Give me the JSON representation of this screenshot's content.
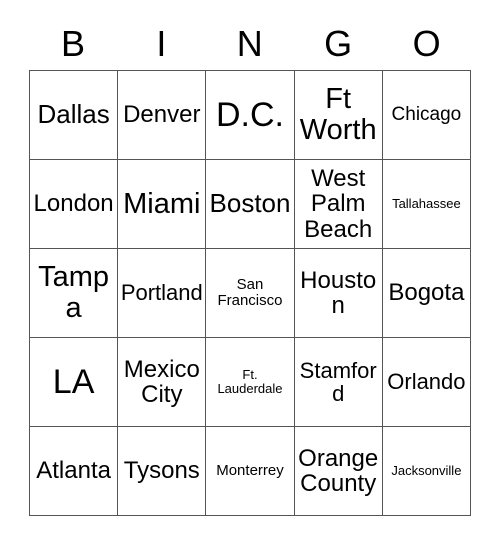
{
  "card": {
    "title": "BINGO card",
    "header_letters": [
      "B",
      "I",
      "N",
      "G",
      "O"
    ],
    "columns": 5,
    "rows": 5,
    "colors": {
      "border": "#555555",
      "text": "#000000",
      "background": "#ffffff"
    }
  },
  "cells": [
    {
      "text": "Dallas",
      "row": 1,
      "col": 1,
      "column_letter": "B",
      "size": "lg"
    },
    {
      "text": "Denver",
      "row": 1,
      "col": 2,
      "column_letter": "I",
      "size": "md"
    },
    {
      "text": "D.C.",
      "row": 1,
      "col": 3,
      "column_letter": "N",
      "size": "xxl"
    },
    {
      "text": "Ft Worth",
      "row": 1,
      "col": 4,
      "column_letter": "G",
      "size": "xl"
    },
    {
      "text": "Chicago",
      "row": 1,
      "col": 5,
      "column_letter": "O",
      "size": "xs"
    },
    {
      "text": "London",
      "row": 2,
      "col": 1,
      "column_letter": "B",
      "size": "md"
    },
    {
      "text": "Miami",
      "row": 2,
      "col": 2,
      "column_letter": "I",
      "size": "xl"
    },
    {
      "text": "Boston",
      "row": 2,
      "col": 3,
      "column_letter": "N",
      "size": "lg"
    },
    {
      "text": "West Palm Beach",
      "row": 2,
      "col": 4,
      "column_letter": "G",
      "size": "md"
    },
    {
      "text": "Tallahassee",
      "row": 2,
      "col": 5,
      "column_letter": "O",
      "size": "tiny"
    },
    {
      "text": "Tampa",
      "row": 3,
      "col": 1,
      "column_letter": "B",
      "size": "xl"
    },
    {
      "text": "Portland",
      "row": 3,
      "col": 2,
      "column_letter": "I",
      "size": "sm"
    },
    {
      "text": "San Francisco",
      "row": 3,
      "col": 3,
      "column_letter": "N",
      "size": "xxs"
    },
    {
      "text": "Houston",
      "row": 3,
      "col": 4,
      "column_letter": "G",
      "size": "md"
    },
    {
      "text": "Bogota",
      "row": 3,
      "col": 5,
      "column_letter": "O",
      "size": "md"
    },
    {
      "text": "LA",
      "row": 4,
      "col": 1,
      "column_letter": "B",
      "size": "xxl"
    },
    {
      "text": "Mexico City",
      "row": 4,
      "col": 2,
      "column_letter": "I",
      "size": "md"
    },
    {
      "text": "Ft. Lauderdale",
      "row": 4,
      "col": 3,
      "column_letter": "N",
      "size": "tiny"
    },
    {
      "text": "Stamford",
      "row": 4,
      "col": 4,
      "column_letter": "G",
      "size": "sm"
    },
    {
      "text": "Orlando",
      "row": 4,
      "col": 5,
      "column_letter": "O",
      "size": "sm"
    },
    {
      "text": "Atlanta",
      "row": 5,
      "col": 1,
      "column_letter": "B",
      "size": "md"
    },
    {
      "text": "Tysons",
      "row": 5,
      "col": 2,
      "column_letter": "I",
      "size": "md"
    },
    {
      "text": "Monterrey",
      "row": 5,
      "col": 3,
      "column_letter": "N",
      "size": "xxs"
    },
    {
      "text": "Orange County",
      "row": 5,
      "col": 4,
      "column_letter": "G",
      "size": "md"
    },
    {
      "text": "Jacksonville",
      "row": 5,
      "col": 5,
      "column_letter": "O",
      "size": "tiny"
    }
  ]
}
